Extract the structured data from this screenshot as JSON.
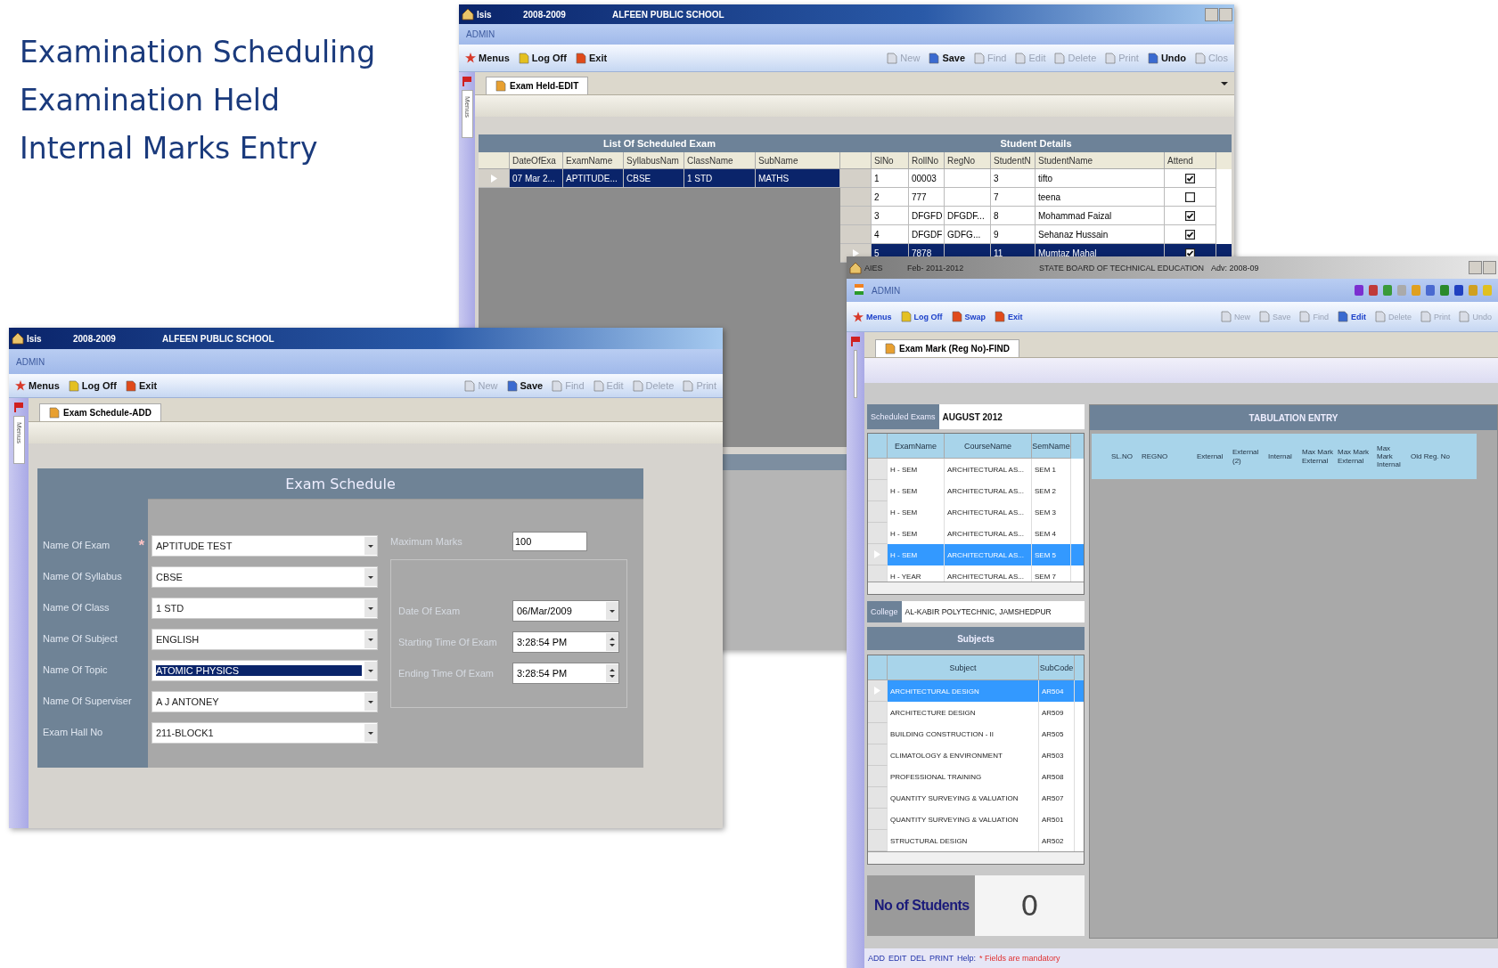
{
  "slide_headings": [
    "Examination Scheduling",
    "Examination Held",
    "Internal Marks Entry"
  ],
  "exam_held_window": {
    "title_bar": {
      "texts": [
        "Isis",
        "2008-2009",
        "ALFEEN PUBLIC SCHOOL"
      ]
    },
    "user_bar": "ADMIN",
    "toolbar": {
      "left": [
        {
          "label": "Menus",
          "disabled": false
        },
        {
          "label": "Log Off",
          "disabled": false
        },
        {
          "label": "Exit",
          "disabled": false
        }
      ],
      "right": [
        {
          "label": "New",
          "disabled": true
        },
        {
          "label": "Save",
          "disabled": false
        },
        {
          "label": "Find",
          "disabled": true
        },
        {
          "label": "Edit",
          "disabled": true
        },
        {
          "label": "Delete",
          "disabled": true
        },
        {
          "label": "Print",
          "disabled": true
        },
        {
          "label": "Undo",
          "disabled": false
        },
        {
          "label": "Clos",
          "disabled": true
        }
      ]
    },
    "side_tab": "Menus",
    "tab": "Exam Held-EDIT",
    "scheduled_exams": {
      "title": "List Of Scheduled Exam",
      "columns": [
        "DateOfExa",
        "ExamName",
        "SyllabusNam",
        "ClassName",
        "SubName"
      ],
      "rows": [
        {
          "cells": [
            "07 Mar 2...",
            "APTITUDE...",
            "CBSE",
            "1 STD",
            "MATHS"
          ],
          "selected": true
        }
      ]
    },
    "student_details": {
      "title": "Student Details",
      "columns": [
        "SlNo",
        "RollNo",
        "RegNo",
        "StudentN",
        "StudentName",
        "Attend"
      ],
      "rows": [
        {
          "sl_no": "1",
          "roll_no": "00003",
          "student_no": "3",
          "student_name": "tifto",
          "attend": true,
          "selected": false
        },
        {
          "sl_no": "2",
          "roll_no": "777",
          "student_no": "7",
          "student_name": "teena",
          "attend": false,
          "selected": false
        },
        {
          "sl_no": "3",
          "roll_no": "DFGFD",
          "reg_no": "DFGDF...",
          "student_no": "8",
          "student_name": "Mohammad Faizal",
          "attend": true,
          "selected": false
        },
        {
          "sl_no": "4",
          "roll_no": "DFGDF",
          "reg_no": "GDFG...",
          "student_no": "9",
          "student_name": "Sehanaz Hussain",
          "attend": true,
          "selected": false
        },
        {
          "sl_no": "5",
          "roll_no": "7878",
          "student_no": "11",
          "student_name": "Mumtaz Mahal",
          "attend": true,
          "selected": true
        }
      ]
    }
  },
  "exam_schedule_window": {
    "title_bar": {
      "texts": [
        "Isis",
        "2008-2009",
        "ALFEEN PUBLIC SCHOOL"
      ]
    },
    "user_bar": "ADMIN",
    "toolbar": {
      "left": [
        {
          "label": "Menus",
          "disabled": false
        },
        {
          "label": "Log Off",
          "disabled": false
        },
        {
          "label": "Exit",
          "disabled": false
        }
      ],
      "right": [
        {
          "label": "New",
          "disabled": true
        },
        {
          "label": "Save",
          "disabled": false
        },
        {
          "label": "Find",
          "disabled": true
        },
        {
          "label": "Edit",
          "disabled": true
        },
        {
          "label": "Delete",
          "disabled": true
        },
        {
          "label": "Print",
          "disabled": true
        }
      ]
    },
    "side_tab": "Menus",
    "tab": "Exam Schedule-ADD",
    "form": {
      "title": "Exam Schedule",
      "fields": [
        {
          "label": "Name Of Exam",
          "marker": "*",
          "value": "APTITUDE TEST",
          "highlighted": false
        },
        {
          "label": "Name Of Syllabus",
          "value": "CBSE",
          "highlighted": false
        },
        {
          "label": "Name Of Class",
          "value": "1 STD",
          "highlighted": false
        },
        {
          "label": "Name Of Subject",
          "value": "ENGLISH",
          "highlighted": false
        },
        {
          "label": "Name Of Topic",
          "value": "ATOMIC PHYSICS",
          "highlighted": true
        },
        {
          "label": "Name Of Superviser",
          "value": "A J ANTONEY",
          "highlighted": false
        },
        {
          "label": "Exam Hall No",
          "value": "211-BLOCK1",
          "highlighted": false
        }
      ],
      "maximum_marks": {
        "label": "Maximum Marks",
        "value": "100"
      },
      "timing": [
        {
          "kind": "date",
          "label": "Date Of Exam",
          "value": "06/Mar/2009"
        },
        {
          "kind": "time",
          "label": "Starting Time Of Exam",
          "value": "3:28:54 PM"
        },
        {
          "kind": "time",
          "label": "Ending Time Of Exam",
          "value": "3:28:54 PM"
        }
      ]
    }
  },
  "exam_mark_window": {
    "title_bar": {
      "texts": [
        "AIES",
        "Feb- 2011-2012",
        "STATE BOARD OF TECHNICAL EDUCATION",
        "Adv: 2008-09"
      ]
    },
    "user_bar": "ADMIN",
    "toolbar": {
      "left": [
        {
          "label": "Menus",
          "disabled": false
        },
        {
          "label": "Log Off",
          "disabled": false
        },
        {
          "label": "Swap",
          "disabled": false
        },
        {
          "label": "Exit",
          "disabled": false
        }
      ],
      "right": [
        {
          "label": "New",
          "disabled": true
        },
        {
          "label": "Save",
          "disabled": true
        },
        {
          "label": "Find",
          "disabled": true
        },
        {
          "label": "Edit",
          "disabled": false
        },
        {
          "label": "Delete",
          "disabled": true
        },
        {
          "label": "Print",
          "disabled": true
        },
        {
          "label": "Undo",
          "disabled": true
        }
      ]
    },
    "tab": "Exam Mark (Reg No)-FIND",
    "scheduled_exams": {
      "label": "Scheduled Exams",
      "value": "AUGUST 2012",
      "columns": [
        "ExamName",
        "CourseName",
        "SemName"
      ],
      "rows": [
        {
          "cells": [
            "H - SEM",
            "ARCHITECTURAL AS...",
            "SEM 1"
          ],
          "selected": false
        },
        {
          "cells": [
            "H - SEM",
            "ARCHITECTURAL AS...",
            "SEM 2"
          ],
          "selected": false
        },
        {
          "cells": [
            "H - SEM",
            "ARCHITECTURAL AS...",
            "SEM 3"
          ],
          "selected": false
        },
        {
          "cells": [
            "H - SEM",
            "ARCHITECTURAL AS...",
            "SEM 4"
          ],
          "selected": false
        },
        {
          "cells": [
            "H - SEM",
            "ARCHITECTURAL AS...",
            "SEM 5"
          ],
          "selected": true
        },
        {
          "cells": [
            "H - YEAR",
            "ARCHITECTURAL AS...",
            "SEM 7"
          ],
          "selected": false
        }
      ]
    },
    "college": {
      "label": "College",
      "value": "AL-KABIR POLYTECHNIC, JAMSHEDPUR"
    },
    "subjects": {
      "title": "Subjects",
      "columns": [
        "Subject",
        "SubCode"
      ],
      "rows": [
        {
          "cells": [
            "ARCHITECTURAL DESIGN",
            "AR504"
          ],
          "selected": true
        },
        {
          "cells": [
            "ARCHITECTURE DESIGN",
            "AR509"
          ],
          "selected": false
        },
        {
          "cells": [
            "BUILDING CONSTRUCTION - II",
            "AR505"
          ],
          "selected": false
        },
        {
          "cells": [
            "CLIMATOLOGY & ENVIRONMENT",
            "AR503"
          ],
          "selected": false
        },
        {
          "cells": [
            "PROFESSIONAL TRAINING",
            "AR508"
          ],
          "selected": false
        },
        {
          "cells": [
            "QUANTITY SURVEYING & VALUATION",
            "AR507"
          ],
          "selected": false
        },
        {
          "cells": [
            "QUANTITY SURVEYING & VALUATION",
            "AR501"
          ],
          "selected": false
        },
        {
          "cells": [
            "STRUCTURAL DESIGN",
            "AR502"
          ],
          "selected": false
        }
      ]
    },
    "student_count": {
      "label": "No of Students",
      "value": "0"
    },
    "tabulation": {
      "title": "TABULATION ENTRY",
      "columns": [
        "SL.NO",
        "REGNO",
        "External",
        "External (2)",
        "Internal",
        "Max Mark External",
        "Max Mark External",
        "Max Mark Internal",
        "Old Reg. No"
      ]
    },
    "status_bar": {
      "shortcuts": [
        "ADD",
        "EDIT",
        "DEL",
        "PRINT"
      ],
      "help_label": "Help:",
      "note": "* Fields are mandatory"
    }
  }
}
